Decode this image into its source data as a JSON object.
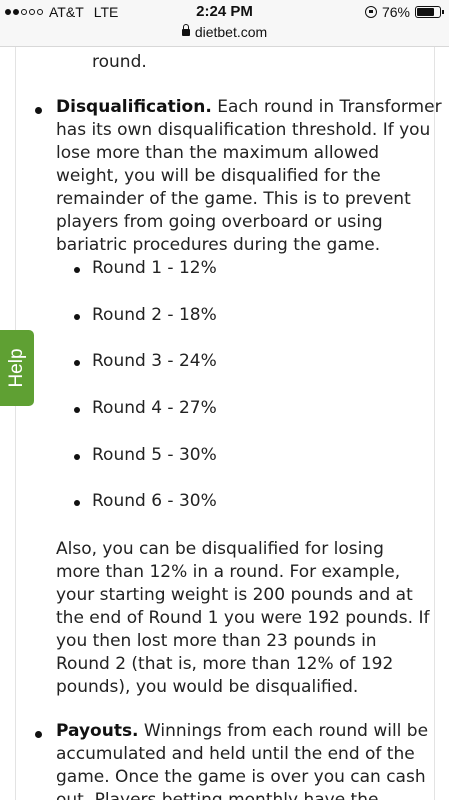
{
  "status_bar": {
    "carrier": "AT&T",
    "network": "LTE",
    "time": "2:24 PM",
    "battery_percent": "76%",
    "battery_level": 0.76
  },
  "browser": {
    "url": "dietbet.com"
  },
  "content": {
    "prev_line_end": "round.",
    "disqualification": {
      "title": "Disqualification.",
      "lines": [
        " Each round in Transformer",
        "has its own disqualification threshold. If you",
        "lose more than the maximum allowed",
        "weight, you will be disqualified for the",
        "remainder of the game. This is to prevent",
        "players from going overboard or using",
        "bariatric procedures during the game."
      ],
      "rounds": [
        "Round 1 - 12%",
        "Round 2 - 18%",
        "Round 3 - 24%",
        "Round 4 - 27%",
        "Round 5 - 30%",
        "Round 6 - 30%"
      ],
      "note_lines": [
        "Also, you can be disqualified for losing",
        "more than 12% in a round. For example,",
        "your starting weight is 200 pounds and at",
        "the end of Round 1 you were 192 pounds. If",
        "you then lost more than 23 pounds in",
        "Round 2 (that is, more than 12% of 192",
        "pounds), you would be disqualified."
      ]
    },
    "payouts": {
      "title": "Payouts.",
      "lines": [
        " Winnings from each round will be",
        "accumulated and held until the end of the",
        "game. Once the game is over you can cash",
        "out. Players betting monthly have the"
      ]
    }
  },
  "help_tab": {
    "label": "Help"
  }
}
